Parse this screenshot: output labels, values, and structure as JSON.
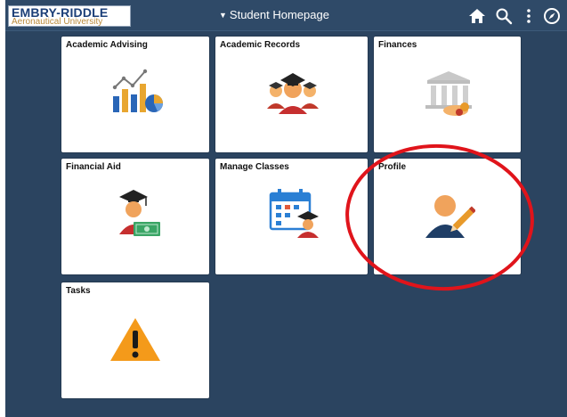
{
  "header": {
    "logo_line1": "EMBRY-RIDDLE",
    "logo_line2": "Aeronautical University",
    "title": "Student Homepage"
  },
  "tiles": [
    {
      "label": "Academic Advising"
    },
    {
      "label": "Academic Records"
    },
    {
      "label": "Finances"
    },
    {
      "label": "Financial Aid"
    },
    {
      "label": "Manage Classes"
    },
    {
      "label": "Profile"
    },
    {
      "label": "Tasks"
    }
  ],
  "colors": {
    "background": "#2b4460",
    "header": "#2f4a68",
    "annotation_circle": "#e0141b",
    "warning": "#f49a1a"
  },
  "icons": {
    "home": "home-icon",
    "search": "search-icon",
    "more": "more-vertical-icon",
    "navbar": "compass-icon"
  }
}
